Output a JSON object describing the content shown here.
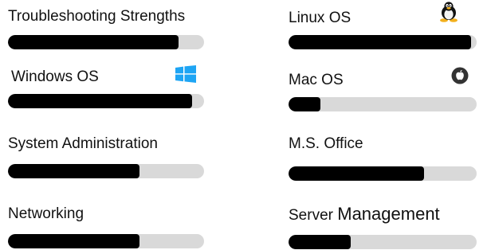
{
  "skills": [
    {
      "label": "Troubleshooting Strengths",
      "level": 0.87
    },
    {
      "label": "Windows OS",
      "level": 0.94,
      "icon": "windows-logo-icon",
      "icon_color": "#1ea5f4"
    },
    {
      "label": "System Administration",
      "level": 0.67
    },
    {
      "label": "Networking",
      "level": 0.67
    },
    {
      "label": "Linux OS",
      "level": 0.97,
      "icon": "linux-tux-icon"
    },
    {
      "label": "Mac OS",
      "level": 0.17,
      "icon": "apple-logo-icon",
      "icon_color": "#333333"
    },
    {
      "label": "M.S. Office",
      "level": 0.72
    },
    {
      "label_part1": "Server ",
      "label_part2": "Management",
      "level": 0.33
    }
  ],
  "colors": {
    "bar_fill": "#000000",
    "bar_track": "#d9d9d9",
    "text": "#111111"
  }
}
